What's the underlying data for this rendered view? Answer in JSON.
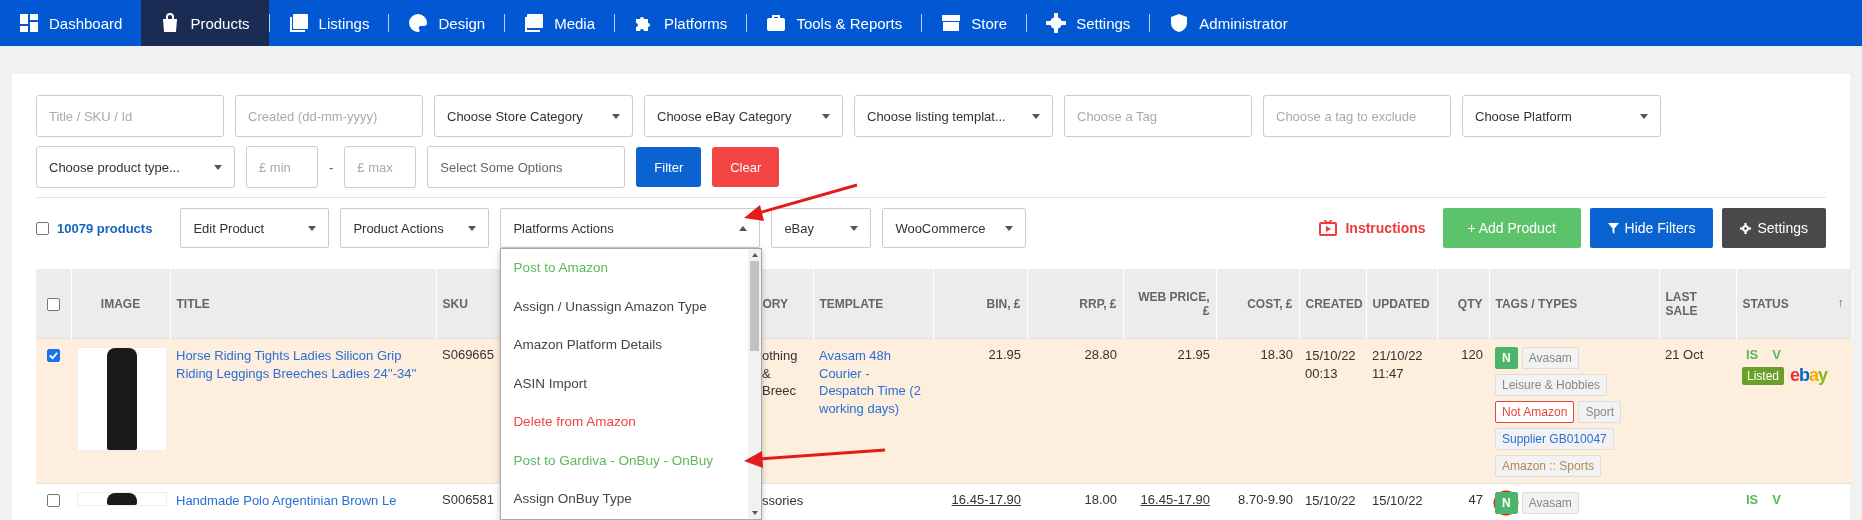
{
  "nav": [
    {
      "label": "Dashboard",
      "selected": false
    },
    {
      "label": "Products",
      "selected": true
    },
    {
      "label": "Listings",
      "selected": false
    },
    {
      "label": "Design",
      "selected": false
    },
    {
      "label": "Media",
      "selected": false
    },
    {
      "label": "Platforms",
      "selected": false
    },
    {
      "label": "Tools & Reports",
      "selected": false
    },
    {
      "label": "Store",
      "selected": false
    },
    {
      "label": "Settings",
      "selected": false
    },
    {
      "label": "Administrator",
      "selected": false
    }
  ],
  "filters": [
    [
      {
        "kind": "input",
        "placeholder": "Title / SKU / Id"
      },
      {
        "kind": "input",
        "placeholder": "Created (dd-mm-yyyy)"
      },
      {
        "kind": "select",
        "value": "Choose Store Category"
      },
      {
        "kind": "select",
        "value": "Choose eBay Category"
      },
      {
        "kind": "select",
        "value": "Choose listing templat..."
      },
      {
        "kind": "input",
        "placeholder": "Choose a Tag"
      },
      {
        "kind": "input",
        "placeholder": "Choose a tag to exclude"
      },
      {
        "kind": "select",
        "value": "Choose Platform"
      }
    ],
    [
      {
        "kind": "select",
        "value": "Choose product type..."
      },
      {
        "kind": "small",
        "placeholder": "£ min"
      },
      {
        "kind": "dash",
        "text": "-"
      },
      {
        "kind": "small",
        "placeholder": "£ max"
      },
      {
        "kind": "multi",
        "placeholder": "Select Some Options"
      },
      {
        "kind": "primary",
        "text": "Filter"
      },
      {
        "kind": "danger",
        "text": "Clear"
      }
    ]
  ],
  "actions": {
    "select_all": {
      "checked": false
    },
    "count": "10079 products",
    "menus": [
      {
        "label": "Edit Product",
        "expanded": false
      },
      {
        "label": "Product Actions",
        "expanded": false
      },
      {
        "label": "Platforms Actions",
        "expanded": true
      },
      {
        "label": "eBay",
        "expanded": false
      },
      {
        "label": "WooCommerce",
        "expanded": false
      }
    ],
    "instructions": "Instructions",
    "add": "+ Add Product",
    "hide_filters": "Hide Filters",
    "settings": "Settings"
  },
  "dropdown": [
    {
      "label": "Post to Amazon",
      "kind": "post"
    },
    {
      "label": "Assign / Unassign Amazon Type",
      "kind": "normal"
    },
    {
      "label": "Amazon Platform Details",
      "kind": "normal"
    },
    {
      "label": "ASIN Import",
      "kind": "normal"
    },
    {
      "label": "Delete from Amazon",
      "kind": "delete"
    },
    {
      "label": "Post to Gardiva - OnBuy - OnBuy",
      "kind": "post"
    },
    {
      "label": "Assign OnBuy Type",
      "kind": "normal"
    }
  ],
  "table": {
    "header_checked": false,
    "columns": [
      "IMAGE",
      "TITLE",
      "SKU",
      "ORY",
      "TEMPLATE",
      "BIN, £",
      "RRP, £",
      "WEB PRICE, £",
      "COST, £",
      "CREATED",
      "UPDATED",
      "QTY",
      "TAGS / TYPES",
      "LAST SALE",
      "STATUS"
    ],
    "sort_mark": "↑",
    "rows": [
      {
        "checked": true,
        "title": "Horse Riding Tights Ladies Silicon Grip Riding Leggings Breeches Ladies 24''-34''",
        "sku": "S069665",
        "category": "othing & Breec",
        "template": "Avasam 48h Courier - Despatch Time (2 working days)",
        "variants": false,
        "bin": "21.95",
        "rrp": "28.80",
        "web": "21.95",
        "cost": "18.30",
        "created": "15/10/22 00:13",
        "updated": "21/10/22 11:47",
        "qty": "120",
        "tags": [
          {
            "label": "N",
            "kind": "new"
          },
          {
            "label": "Avasam",
            "kind": "plain"
          },
          {
            "label": "Leisure & Hobbies",
            "kind": "plain"
          },
          {
            "label": "Not Amazon",
            "kind": "warn"
          },
          {
            "label": "Sport",
            "kind": "plain"
          },
          {
            "label": "Supplier GB010047",
            "kind": "supplier"
          },
          {
            "label": "Amazon :: Sports",
            "kind": "amazon"
          }
        ],
        "last_sale": "21 Oct",
        "status": [
          "IS",
          "V"
        ],
        "listed": "Listed",
        "logo": "ebay"
      },
      {
        "checked": false,
        "title": "Handmade Polo Argentinian Brown Le",
        "sku": "S006581",
        "category": "ssories",
        "variants": true,
        "bin": "16.45-17.90",
        "rrp": "18.00",
        "web": "16.45-17.90",
        "cost": "8.70-9.90",
        "created": "15/10/22",
        "updated": "15/10/22",
        "qty": "47",
        "tags": [
          {
            "label": "N",
            "kind": "blocked"
          },
          {
            "label": "Avasam",
            "kind": "plain"
          }
        ],
        "status": [
          "IS",
          "V"
        ]
      }
    ]
  }
}
